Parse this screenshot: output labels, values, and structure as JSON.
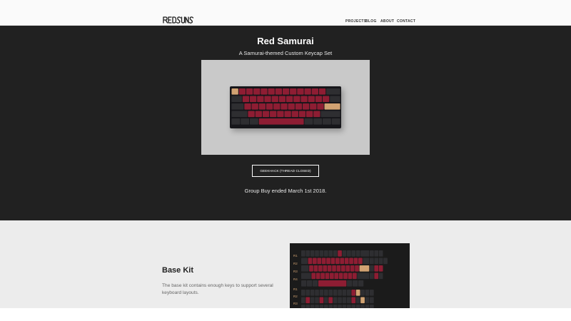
{
  "header": {
    "logo_text": "REDSUNS",
    "nav": [
      "PROJECTS",
      "BLOG",
      "ABOUT",
      "CONTACT"
    ]
  },
  "hero": {
    "title": "Red Samurai",
    "subtitle": "A Samurai-themed Custom Keycap Set",
    "button_label": "GEEKHACK (THREAD CLOSED)",
    "status": "Group Buy ended March 1st 2018."
  },
  "base_kit": {
    "title": "Base Kit",
    "description": "The base kit contains enough keys to support several keyboard layouts.",
    "row_labels": [
      "R1",
      "R2",
      "R3",
      "R4",
      "R1",
      "R2",
      "R3",
      "R4"
    ]
  },
  "colors": {
    "hero_bg": "#212121",
    "keycap_red": "#8e1d33",
    "keycap_dark": "#2e2e31",
    "keycap_gold": "#d1a272",
    "section_bg": "#ececec"
  }
}
